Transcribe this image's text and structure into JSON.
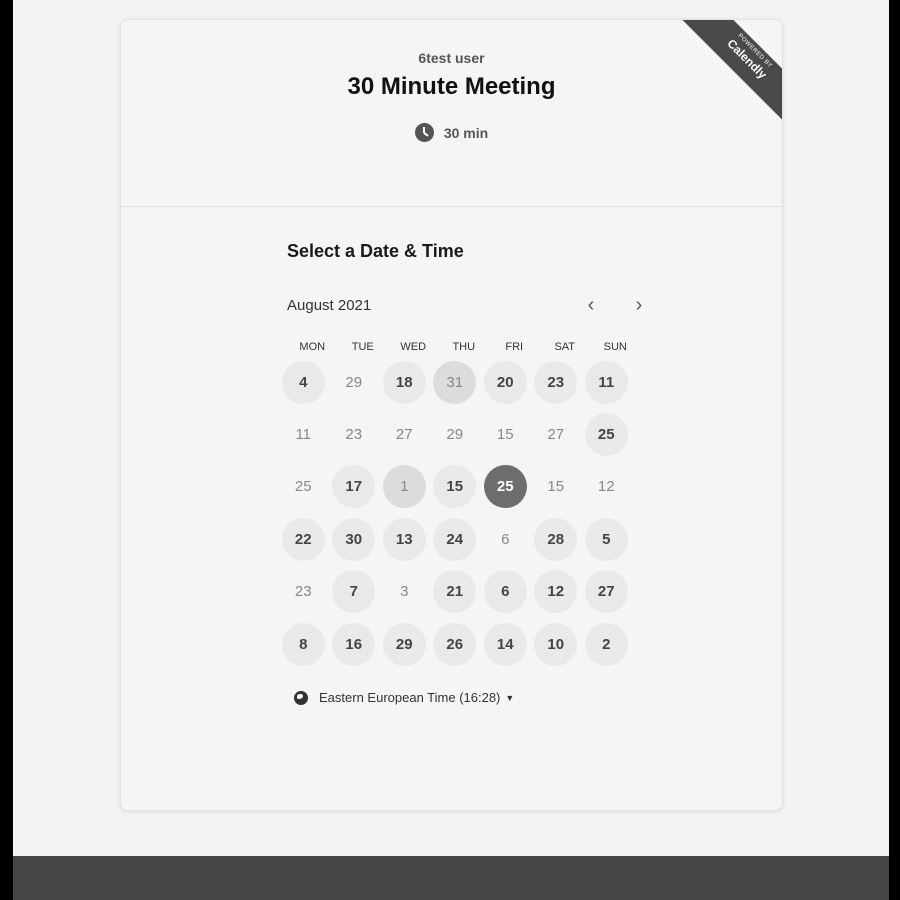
{
  "badge": {
    "powered": "POWERED BY",
    "brand": "Calendly"
  },
  "header": {
    "owner": "6test user",
    "title": "30 Minute Meeting",
    "duration": "30 min"
  },
  "calendar": {
    "section_title": "Select a Date & Time",
    "month": "August 2021",
    "weekdays": [
      "MON",
      "TUE",
      "WED",
      "THU",
      "FRI",
      "SAT",
      "SUN"
    ],
    "rows": [
      [
        {
          "d": "4",
          "s": "avail"
        },
        {
          "d": "29",
          "s": "off"
        },
        {
          "d": "18",
          "s": "avail"
        },
        {
          "d": "31",
          "s": "hover"
        },
        {
          "d": "20",
          "s": "avail"
        },
        {
          "d": "23",
          "s": "avail"
        },
        {
          "d": "11",
          "s": "avail"
        }
      ],
      [
        {
          "d": "11",
          "s": "off"
        },
        {
          "d": "23",
          "s": "off"
        },
        {
          "d": "27",
          "s": "off"
        },
        {
          "d": "29",
          "s": "off"
        },
        {
          "d": "15",
          "s": "off"
        },
        {
          "d": "27",
          "s": "off"
        },
        {
          "d": "25",
          "s": "avail"
        }
      ],
      [
        {
          "d": "25",
          "s": "off"
        },
        {
          "d": "17",
          "s": "avail"
        },
        {
          "d": "1",
          "s": "hover"
        },
        {
          "d": "15",
          "s": "avail"
        },
        {
          "d": "25",
          "s": "sel"
        },
        {
          "d": "15",
          "s": "off"
        },
        {
          "d": "12",
          "s": "off"
        }
      ],
      [
        {
          "d": "22",
          "s": "avail"
        },
        {
          "d": "30",
          "s": "avail"
        },
        {
          "d": "13",
          "s": "avail"
        },
        {
          "d": "24",
          "s": "avail"
        },
        {
          "d": "6",
          "s": "off"
        },
        {
          "d": "28",
          "s": "avail"
        },
        {
          "d": "5",
          "s": "avail"
        }
      ],
      [
        {
          "d": "23",
          "s": "off"
        },
        {
          "d": "7",
          "s": "avail"
        },
        {
          "d": "3",
          "s": "off"
        },
        {
          "d": "21",
          "s": "avail"
        },
        {
          "d": "6",
          "s": "avail"
        },
        {
          "d": "12",
          "s": "avail"
        },
        {
          "d": "27",
          "s": "avail"
        }
      ],
      [
        {
          "d": "8",
          "s": "avail"
        },
        {
          "d": "16",
          "s": "avail"
        },
        {
          "d": "29",
          "s": "avail"
        },
        {
          "d": "26",
          "s": "avail"
        },
        {
          "d": "14",
          "s": "avail"
        },
        {
          "d": "10",
          "s": "avail"
        },
        {
          "d": "2",
          "s": "avail"
        }
      ]
    ],
    "timezone": "Eastern European Time (16:28)"
  }
}
